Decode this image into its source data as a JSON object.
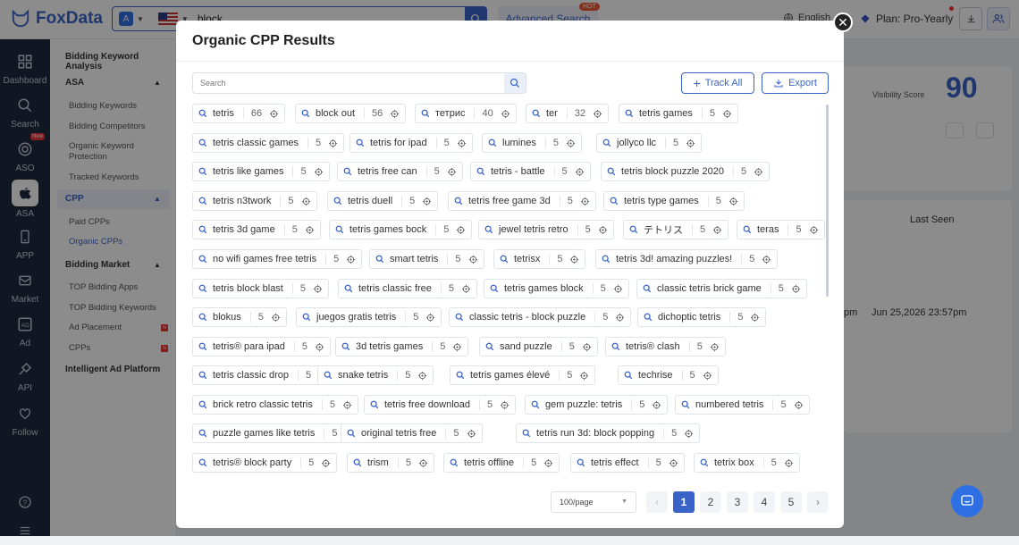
{
  "app": {
    "name": "FoxData"
  },
  "topbar": {
    "search_value": "block",
    "advanced_search": "Advanced Search",
    "hot_badge": "HOT",
    "language": "English",
    "plan": "Plan: Pro-Yearly"
  },
  "sidebar": {
    "items": [
      {
        "label": "Dashboard",
        "icon": "dashboard-icon"
      },
      {
        "label": "Search",
        "icon": "search-icon"
      },
      {
        "label": "ASO",
        "icon": "aso-icon",
        "badge": "New"
      },
      {
        "label": "ASA",
        "icon": "apple-icon",
        "active": true
      },
      {
        "label": "APP",
        "icon": "phone-icon"
      },
      {
        "label": "Market",
        "icon": "mail-icon"
      },
      {
        "label": "Ad",
        "icon": "ad-icon"
      },
      {
        "label": "API",
        "icon": "satellite-icon"
      },
      {
        "label": "Follow",
        "icon": "heart-icon"
      }
    ]
  },
  "subnav": {
    "bidding_keyword_analysis": "Bidding Keyword Analysis",
    "asa": "ASA",
    "bidding_keywords": "Bidding Keywords",
    "bidding_competitors": "Bidding Competitors",
    "organic_keyword_protection": "Organic Keyword Protection",
    "tracked_keywords": "Tracked Keywords",
    "cpp": "CPP",
    "paid_cpps": "Paid CPPs",
    "organic_cpps": "Organic CPPs",
    "bidding_market": "Bidding Market",
    "top_bidding_apps": "TOP Bidding Apps",
    "top_bidding_keywords": "TOP Bidding Keywords",
    "ad_placement": "Ad Placement",
    "cpps": "CPPs",
    "intelligent_ad_platform": "Intelligent Ad Platform",
    "n_badge": "N"
  },
  "background": {
    "visibility_label": "Visibility Score",
    "visibility_value": "90",
    "last_seen_header": "Last Seen",
    "date_value": "Jun 25,2026 23:57pm",
    "time_fragment": "pm"
  },
  "modal": {
    "title": "Organic CPP Results",
    "search_placeholder": "Search",
    "track_all": "Track All",
    "export": "Export",
    "per_page": "100/page",
    "pages": [
      "1",
      "2",
      "3",
      "4",
      "5"
    ],
    "current_page": "1",
    "rows": [
      [
        {
          "k": "tetris",
          "n": "66"
        },
        {
          "k": "block out",
          "n": "56"
        },
        {
          "k": "тетрис",
          "n": "40"
        },
        {
          "k": "ter",
          "n": "32"
        },
        {
          "k": "tetris games",
          "n": "5"
        }
      ],
      [
        {
          "k": "tetris classic games",
          "n": "5"
        },
        {
          "k": "tetris for ipad",
          "n": "5"
        },
        {
          "k": "lumines",
          "n": "5"
        },
        {
          "k": "jollyco llc",
          "n": "5"
        }
      ],
      [
        {
          "k": "tetris like games",
          "n": "5"
        },
        {
          "k": "tetris free can",
          "n": "5"
        },
        {
          "k": "tetris - battle",
          "n": "5"
        },
        {
          "k": "tetris block puzzle 2020",
          "n": "5"
        }
      ],
      [
        {
          "k": "tetris n3twork",
          "n": "5"
        },
        {
          "k": "tetris duell",
          "n": "5"
        },
        {
          "k": "tetris free game 3d",
          "n": "5"
        },
        {
          "k": "tetris type games",
          "n": "5"
        }
      ],
      [
        {
          "k": "tetris 3d game",
          "n": "5"
        },
        {
          "k": "tetris games bock",
          "n": "5"
        },
        {
          "k": "jewel tetris retro",
          "n": "5"
        },
        {
          "k": "テトリス",
          "n": "5"
        },
        {
          "k": "teras",
          "n": "5"
        }
      ],
      [
        {
          "k": "no wifi games free tetris",
          "n": "5"
        },
        {
          "k": "smart tetris",
          "n": "5"
        },
        {
          "k": "tetrisx",
          "n": "5"
        },
        {
          "k": "tetris 3d! amazing puzzles!",
          "n": "5"
        }
      ],
      [
        {
          "k": "tetris block blast",
          "n": "5"
        },
        {
          "k": "tetris classic free",
          "n": "5"
        },
        {
          "k": "tetris games block",
          "n": "5"
        },
        {
          "k": "classic tetris brick game",
          "n": "5"
        }
      ],
      [
        {
          "k": "blokus",
          "n": "5"
        },
        {
          "k": "juegos gratis tetris",
          "n": "5"
        },
        {
          "k": "classic tetris - block puzzle",
          "n": "5"
        },
        {
          "k": "dichoptic tetris",
          "n": "5"
        }
      ],
      [
        {
          "k": "tetris® para ipad",
          "n": "5"
        },
        {
          "k": "3d tetris games",
          "n": "5"
        },
        {
          "k": "sand puzzle",
          "n": "5"
        },
        {
          "k": "tetris® clash",
          "n": "5"
        }
      ],
      [
        {
          "k": "tetris classic drop",
          "n": "5"
        },
        {
          "k": "snake tetris",
          "n": "5"
        },
        {
          "k": "tetris games élevé",
          "n": "5"
        },
        {
          "k": "techrise",
          "n": "5"
        }
      ],
      [
        {
          "k": "brick retro classic tetris",
          "n": "5"
        },
        {
          "k": "tetris free download",
          "n": "5"
        },
        {
          "k": "gem puzzle: tetris",
          "n": "5"
        },
        {
          "k": "numbered tetris",
          "n": "5"
        }
      ],
      [
        {
          "k": "puzzle games like tetris",
          "n": "5"
        },
        {
          "k": "original tetris free",
          "n": "5"
        },
        {
          "k": "tetris run 3d: block popping",
          "n": "5"
        }
      ],
      [
        {
          "k": "tetris® block party",
          "n": "5"
        },
        {
          "k": "trism",
          "n": "5"
        },
        {
          "k": "tetris offline",
          "n": "5"
        },
        {
          "k": "tetris effect",
          "n": "5"
        },
        {
          "k": "tetrix box",
          "n": "5"
        }
      ]
    ]
  }
}
